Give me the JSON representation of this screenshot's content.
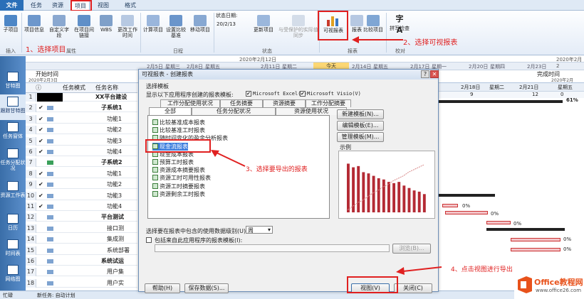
{
  "tabs": [
    "文件",
    "任务",
    "资源",
    "项目",
    "视图",
    "格式"
  ],
  "ribbon": {
    "buttons": [
      "子项目",
      "项目信息",
      "自定义字段",
      "在项目间链接",
      "WBS",
      "更改工作时间",
      "计算项目",
      "设置比较基准",
      "移动项目",
      "状态日期:",
      "20/2/13",
      "更新项目",
      "与受保护的实际值同步",
      "可视报表",
      "报表",
      "比较项目",
      "拼写检查"
    ],
    "groups": [
      "插入",
      "属性",
      "日程",
      "状态",
      "报表",
      "校对"
    ]
  },
  "annotations": {
    "step1": "1、选择项目",
    "step2": "2、选择可视报表",
    "step3": "3、选择要导出的报表",
    "step4": "4、点击视图进行导出"
  },
  "leftbar": [
    "甘特图",
    "跟踪甘特图",
    "任务窗体",
    "任务分配状况",
    "资源工作表",
    "日历",
    "时间表",
    "网络图"
  ],
  "timeline": {
    "top_left": "2020年2月12日",
    "today": "今天",
    "start_label": "开始时间",
    "start_date": "2020年2月3日",
    "finish_label": "完成时间",
    "finish_date": "2020年2月",
    "right_date": "2020年2月2",
    "dates": [
      "2月5日",
      "星期三",
      "2月8日",
      "星期五",
      "2月11日",
      "星期二",
      "2月14日",
      "星期五",
      "2月17日",
      "星期一",
      "2月20日",
      "星期四",
      "2月23日"
    ],
    "gantt_header": [
      "2月18日",
      "星期二",
      "2月21日",
      "星期五",
      "9",
      "12",
      "0"
    ]
  },
  "table": {
    "headers": [
      "任务模式",
      "任务名称"
    ],
    "rows": [
      {
        "n": "1",
        "name": "XX平台建设"
      },
      {
        "n": "2",
        "name": "子系统1"
      },
      {
        "n": "3",
        "name": "功能1"
      },
      {
        "n": "4",
        "name": "功能2"
      },
      {
        "n": "5",
        "name": "功能3"
      },
      {
        "n": "6",
        "name": "功能4"
      },
      {
        "n": "7",
        "name": "子系统2"
      },
      {
        "n": "8",
        "name": "功能1"
      },
      {
        "n": "9",
        "name": "功能2"
      },
      {
        "n": "10",
        "name": "功能3"
      },
      {
        "n": "11",
        "name": "功能4"
      },
      {
        "n": "12",
        "name": "平台测试"
      },
      {
        "n": "13",
        "name": "接口测"
      },
      {
        "n": "14",
        "name": "集成测"
      },
      {
        "n": "15",
        "name": "系统部署"
      },
      {
        "n": "16",
        "name": "系统试运"
      },
      {
        "n": "17",
        "name": "用户集"
      },
      {
        "n": "18",
        "name": "用户实"
      }
    ]
  },
  "gantt": {
    "pct_top": "61%",
    "pcts": [
      "0%",
      "0%",
      "0%",
      "0%",
      "0%"
    ]
  },
  "dialog": {
    "title": "可视报表 - 创建报表",
    "section": "选择模板",
    "show_label": "显示以下应用程序创建的报表模板:",
    "excel": "Microsoft Excel(X)",
    "visio": "Microsoft Visio(V)",
    "tabs_row1": [
      "工作分配使用状况",
      "任务摘要",
      "资源摘要",
      "工作分配摘要"
    ],
    "tabs_row2": [
      "全部",
      "任务分配状况",
      "资源使用状况"
    ],
    "list": [
      "比较基准成本报表",
      "比较基准工时报表",
      "随时间变化的盈余分析报表",
      "现金流报表",
      "现金成本报表",
      "预算工时报表",
      "资源成本摘要报表",
      "资源工时可用性报表",
      "资源工时摘要报表",
      "资源剩余工时报表"
    ],
    "selected": "现金流报表",
    "side_buttons": [
      "新建模板(N)...",
      "编辑模板(E)...",
      "管理模板(M)..."
    ],
    "sample_label": "示例",
    "level_label": "选择要在报表中包含的使用数据级别(U):",
    "level_value": "周",
    "include_label": "包括来自此应用程序的报表模板(I):",
    "browse": "浏览(B)...",
    "help": "帮助(H)",
    "save": "保存数据(S)...",
    "view": "视图(V)",
    "close": "关闭(C)"
  },
  "chart_data": {
    "type": "bar",
    "values": [
      40,
      37,
      38,
      33,
      32,
      30,
      28,
      27,
      25,
      24,
      25,
      22,
      20,
      18,
      17,
      15
    ],
    "line": [
      2,
      5,
      8,
      10,
      13,
      16,
      18,
      21,
      23,
      26,
      28,
      30,
      33,
      35,
      37,
      39
    ]
  },
  "status": {
    "ready": "忙碌",
    "new_task": "新任务: 自动计划"
  },
  "logo": {
    "brand": "Office教程网",
    "url": "www.office26.com"
  },
  "colors": {
    "accent": "#2a6fb8",
    "annotation": "#e02020",
    "bar": "#b42a34"
  }
}
